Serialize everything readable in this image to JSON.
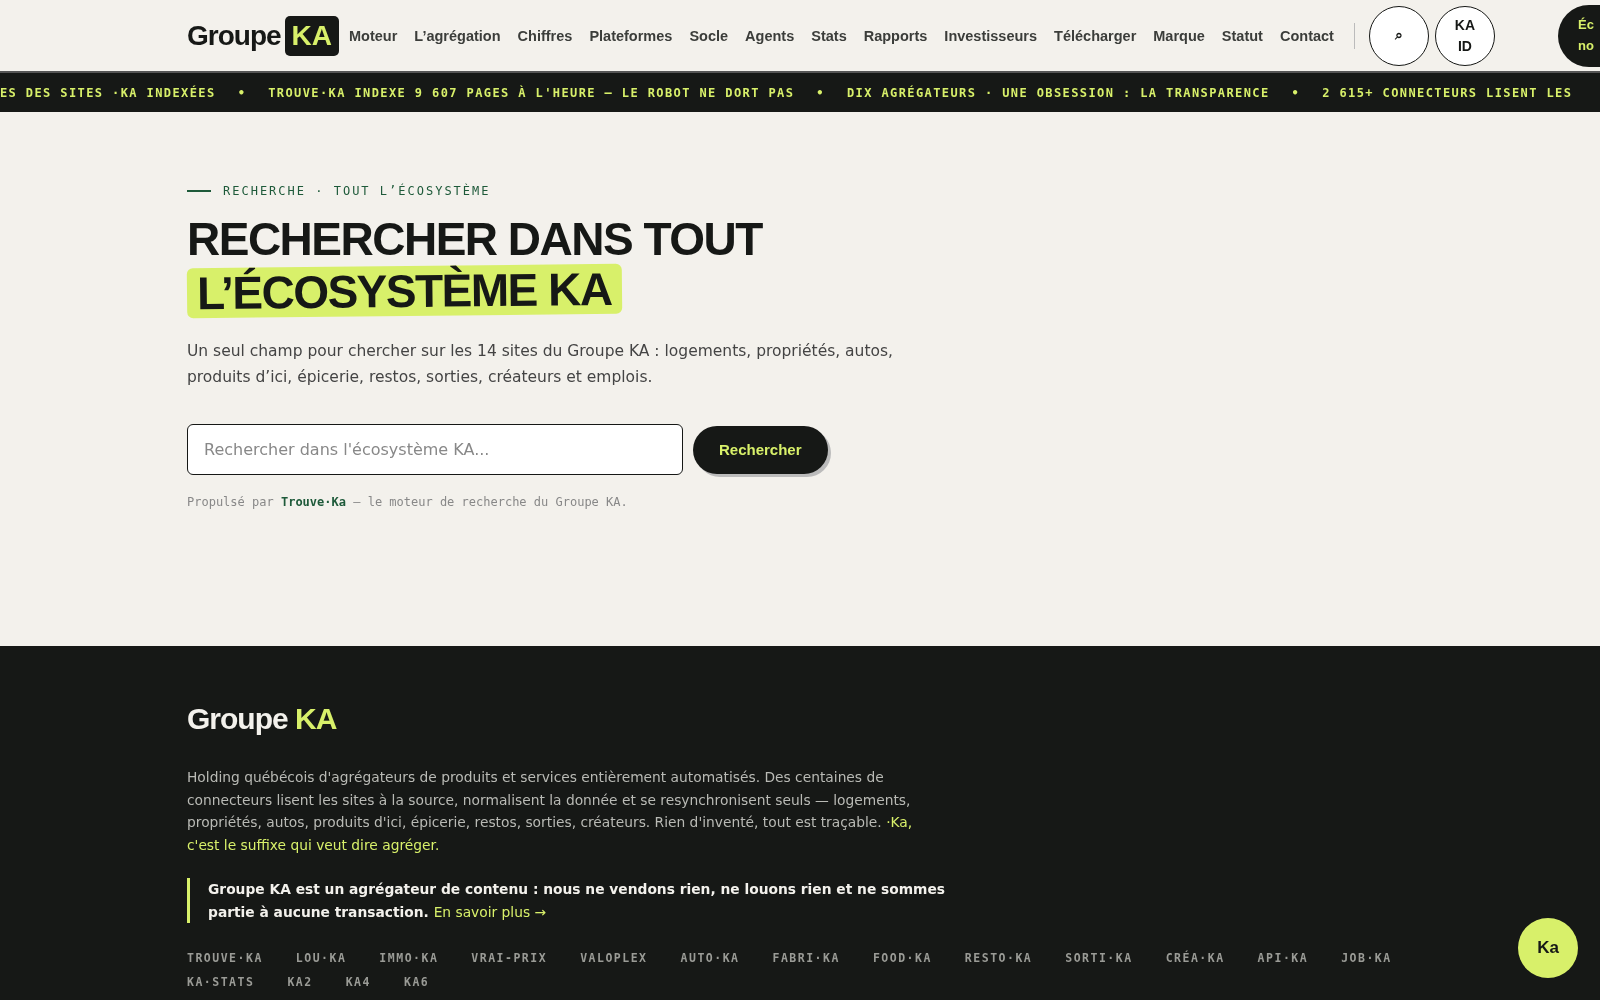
{
  "header": {
    "logo": {
      "text": "Groupe",
      "badge": "KA"
    },
    "nav": [
      "Moteur",
      "L’agrégation",
      "Chiffres",
      "Plateformes",
      "Socle",
      "Agents",
      "Stats",
      "Rapports",
      "Investisseurs",
      "Télécharger",
      "Marque",
      "Statut",
      "Contact"
    ],
    "search_button": "⌕",
    "id_button": [
      "KA",
      "ID"
    ],
    "cta_button": [
      "Éc",
      "no"
    ]
  },
  "ticker": [
    "ES DES SITES ·KA INDEXÉES",
    "TROUVE·KA INDEXE 9 607 PAGES À L'HEURE — LE ROBOT NE DORT PAS",
    "DIX AGRÉGATEURS · UNE OBSESSION : LA TRANSPARENCE",
    "2 615+ CONNECTEURS LISENT LES"
  ],
  "ticker_separator": "•",
  "hero": {
    "eyebrow": "RECHERCHE · TOUT L’ÉCOSYSTÈME",
    "title": "RECHERCHER DANS TOUT",
    "title_highlight": "L’ÉCOSYSTÈME KA",
    "intro": "Un seul champ pour chercher sur les 14 sites du Groupe KA : logements, propriétés, autos, produits d’ici, épicerie, restos, sorties, créateurs et emplois.",
    "search": {
      "placeholder": "Rechercher dans l'écosystème KA..."
    },
    "search_button": "Rechercher",
    "powered": {
      "before": "Propulsé par",
      "link": "Trouve·Ka",
      "after": "— le moteur de recherche du Groupe KA."
    }
  },
  "footer": {
    "logo": {
      "text": "Groupe",
      "accent": "KA"
    },
    "about": "Holding québécois d'agrégateurs de produits et services entièrement automatisés. Des centaines de connecteurs lisent les sites à la source, normalisent la donnée et se resynchronisent seuls — logements, propriétés, autos, produits d'ici, épicerie, restos, sorties, créateurs. Rien d'inventé, tout est traçable.",
    "about_accent": "·Ka, c'est le suffixe qui veut dire agréger.",
    "notice": "Groupe KA est un agrégateur de contenu : nous ne vendons rien, ne louons rien et ne sommes partie à aucune transaction.",
    "notice_link": "En savoir plus →",
    "sites": [
      "TROUVE·KA",
      "LOU·KA",
      "IMMO·KA",
      "VRAI-PRIX",
      "VALOPLEX",
      "AUTO·KA",
      "FABRI·KA",
      "FOOD·KA",
      "RESTO·KA",
      "SORTI·KA",
      "CRÉA·KA",
      "API·KA",
      "JOB·KA",
      "KA·STATS",
      "KA2",
      "KA4",
      "KA6"
    ]
  },
  "chat_button": "Ka"
}
